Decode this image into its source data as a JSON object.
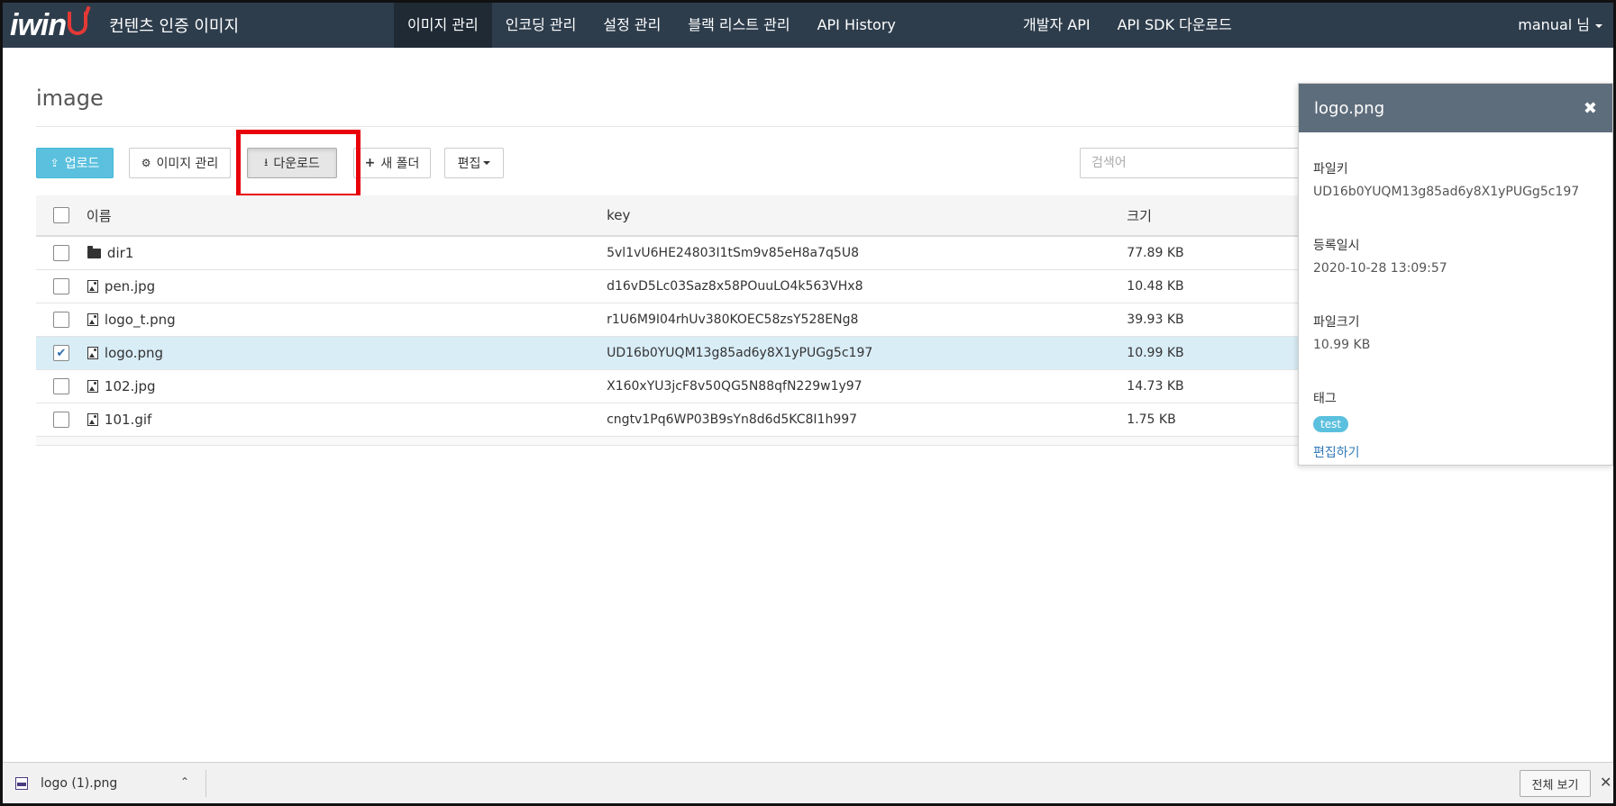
{
  "app": {
    "logo_text": "iwin",
    "title": "컨텐츠 인증 이미지"
  },
  "nav": {
    "items": [
      {
        "label": "이미지 관리",
        "active": true
      },
      {
        "label": "인코딩 관리"
      },
      {
        "label": "설정 관리"
      },
      {
        "label": "블랙 리스트 관리"
      },
      {
        "label": "API History"
      }
    ],
    "right_items": [
      {
        "label": "개발자 API"
      },
      {
        "label": "API SDK 다운로드"
      }
    ],
    "user": "manual 님"
  },
  "page": {
    "title": "image"
  },
  "toolbar": {
    "upload": "업로드",
    "manage": "이미지 관리",
    "download": "다운로드",
    "new_folder": "새 폴더",
    "edit": "편집",
    "search_placeholder": "검색어"
  },
  "table": {
    "headers": {
      "name": "이름",
      "key": "key",
      "size": "크기"
    },
    "rows": [
      {
        "type": "folder",
        "name": "dir1",
        "key": "5vl1vU6HE24803I1tSm9v85eH8a7q5U8",
        "size": "77.89 KB",
        "checked": false
      },
      {
        "type": "image",
        "name": "pen.jpg",
        "key": "d16vD5Lc03Saz8x58POuuLO4k563VHx8",
        "size": "10.48 KB",
        "checked": false
      },
      {
        "type": "image",
        "name": "logo_t.png",
        "key": "r1U6M9I04rhUv380KOEC58zsY528ENg8",
        "size": "39.93 KB",
        "checked": false
      },
      {
        "type": "image",
        "name": "logo.png",
        "key": "UD16b0YUQM13g85ad6y8X1yPUGg5c197",
        "size": "10.99 KB",
        "checked": true
      },
      {
        "type": "image",
        "name": "102.jpg",
        "key": "X160xYU3jcF8v50QG5N88qfN229w1y97",
        "size": "14.73 KB",
        "checked": false
      },
      {
        "type": "image",
        "name": "101.gif",
        "key": "cngtv1Pq6WP03B9sYn8d6d5KC8I1h997",
        "size": "1.75 KB",
        "checked": false
      }
    ]
  },
  "panel": {
    "title": "logo.png",
    "file_key_label": "파일키",
    "file_key": "UD16b0YUQM13g85ad6y8X1yPUGg5c197",
    "registered_label": "등록일시",
    "registered": "2020-10-28 13:09:57",
    "file_size_label": "파일크기",
    "file_size": "10.99 KB",
    "tag_label": "태그",
    "tag": "test",
    "edit_link": "편집하기"
  },
  "download_bar": {
    "file_name": "logo (1).png",
    "show_all": "전체 보기"
  },
  "colors": {
    "navbar": "#2e3d4c",
    "nav_active": "#1f2a35",
    "accent_info": "#5bc0de",
    "selected_row": "#d9edf7",
    "highlight": "#e8000b",
    "logo_smile": "#e53935"
  }
}
